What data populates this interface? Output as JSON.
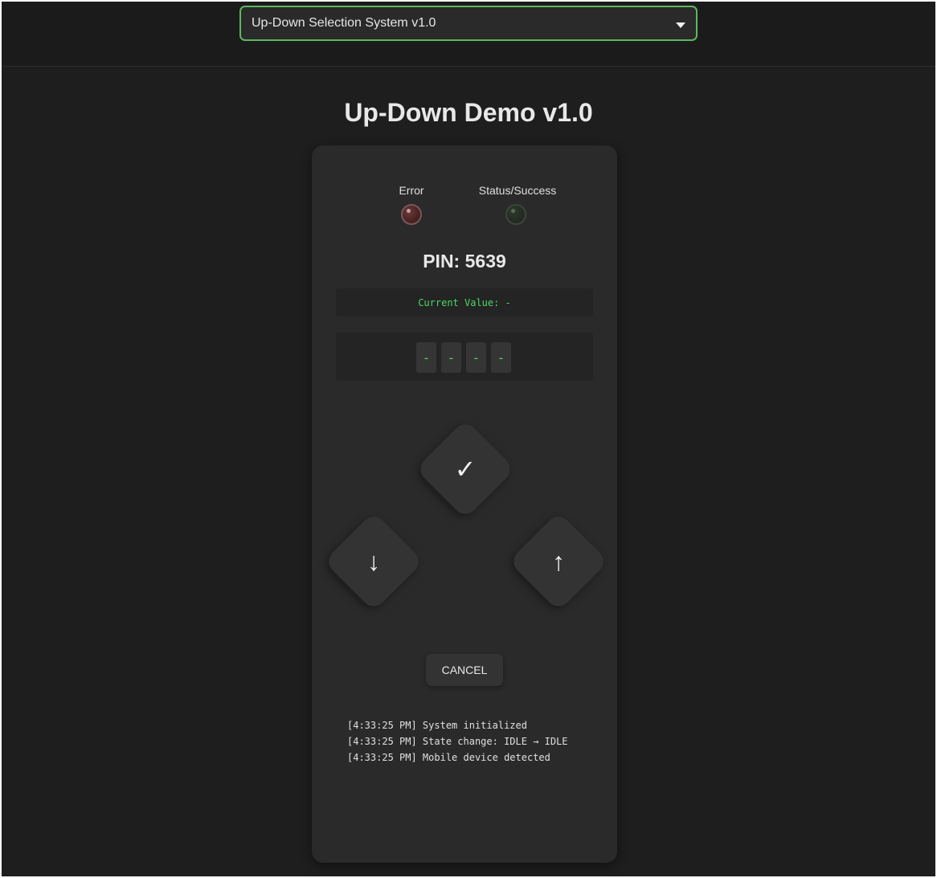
{
  "header": {
    "selector_value": "Up-Down Selection System v1.0",
    "selector_accent": "#5cb85c"
  },
  "title": "Up-Down Demo v1.0",
  "indicators": {
    "error_label": "Error",
    "success_label": "Status/Success",
    "error_color": "#4a2222",
    "success_color": "#232b23"
  },
  "pin": "PIN: 5639",
  "current_value": "Current Value: -",
  "digits": [
    "-",
    "-",
    "-",
    "-"
  ],
  "controls": {
    "confirm_icon": "checkmark-icon",
    "down_icon": "arrow-down-icon",
    "up_icon": "arrow-up-icon",
    "confirm_glyph": "✓",
    "down_glyph": "↓",
    "up_glyph": "↑",
    "cancel_label": "CANCEL"
  },
  "log": [
    "[4:33:25 PM] System initialized",
    "[4:33:25 PM] State change: IDLE → IDLE",
    "[4:33:25 PM] Mobile device detected"
  ],
  "accent_text_color": "#4cd964"
}
